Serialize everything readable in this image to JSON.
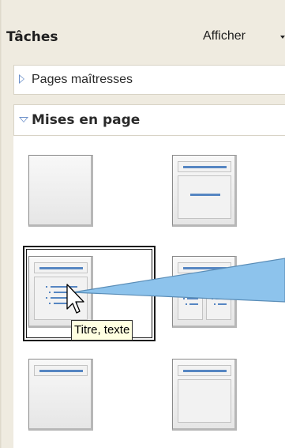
{
  "panel": {
    "title": "Tâches",
    "view_menu_label": "Afficher",
    "view_menu_icon": "chevron-down-icon"
  },
  "sections": {
    "master_pages": {
      "label": "Pages maîtresses",
      "expanded": false
    },
    "layouts": {
      "label": "Mises en page",
      "expanded": true
    }
  },
  "layouts": [
    {
      "name": "blank"
    },
    {
      "name": "title-content"
    },
    {
      "name": "title-text",
      "selected": true
    },
    {
      "name": "title-two-text-columns"
    },
    {
      "name": "title-only"
    },
    {
      "name": "title-text-bottom"
    }
  ],
  "tooltip": {
    "text": "Titre, texte"
  },
  "colors": {
    "panel_bg": "#efebe0",
    "accent_blue": "#5686c2",
    "callout_fill": "#8dc3ec",
    "tooltip_bg": "#ffffe1"
  }
}
